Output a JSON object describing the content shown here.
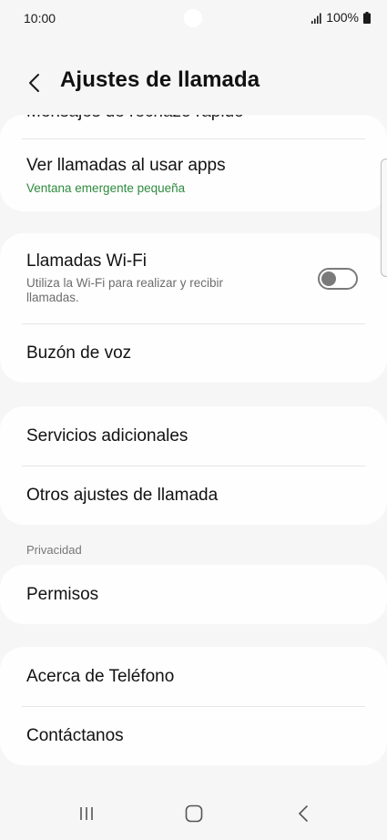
{
  "status_bar": {
    "time": "10:00",
    "battery": "100%"
  },
  "header": {
    "title": "Ajustes de llamada"
  },
  "card1": {
    "cut_off_label": "Mensajes de rechazo rápido",
    "items": [
      {
        "title": "Ver llamadas al usar apps",
        "subtitle": "Ventana emergente pequeña"
      }
    ]
  },
  "card2": {
    "items": [
      {
        "title": "Llamadas Wi-Fi",
        "subtitle": "Utiliza la Wi-Fi para realizar y recibir llamadas.",
        "toggle_on": false
      },
      {
        "title": "Buzón de voz"
      }
    ]
  },
  "card3": {
    "items": [
      {
        "title": "Servicios adicionales"
      },
      {
        "title": "Otros ajustes de llamada"
      }
    ]
  },
  "privacy": {
    "section_label": "Privacidad",
    "items": [
      {
        "title": "Permisos"
      }
    ]
  },
  "card5": {
    "items": [
      {
        "title": "Acerca de Teléfono"
      },
      {
        "title": "Contáctanos"
      }
    ]
  },
  "colors": {
    "background": "#f6f6f6",
    "card": "#fefefe",
    "accent_green": "#2e8b3f",
    "toggle_off": "#7a7a7a"
  },
  "icons": {
    "back": "chevron-left-icon",
    "signal": "signal-icon",
    "battery": "battery-icon",
    "recents": "recents-icon",
    "home": "home-icon",
    "nav_back": "nav-back-icon"
  }
}
